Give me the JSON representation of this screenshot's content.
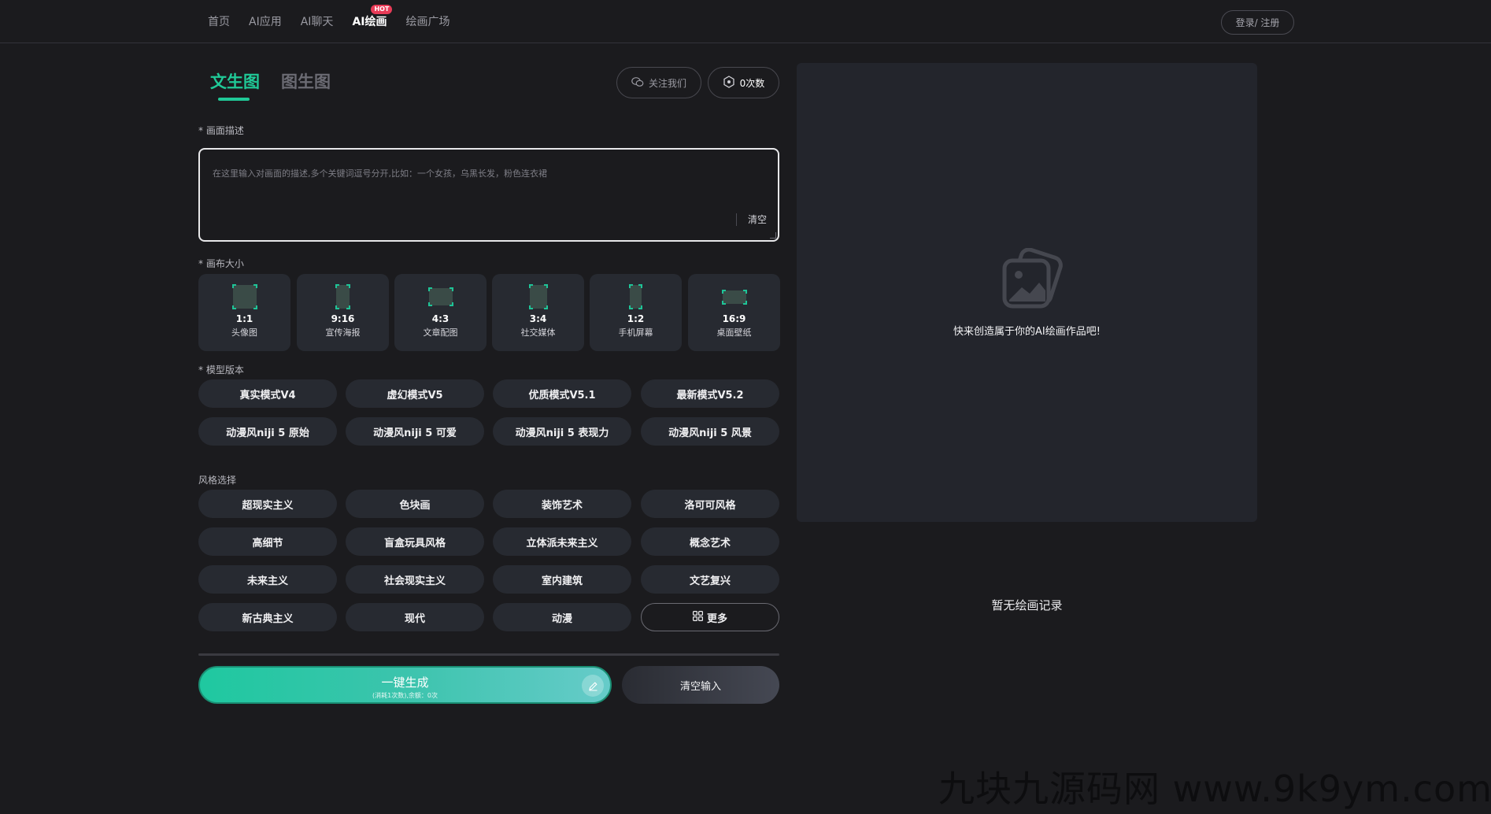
{
  "nav": {
    "items": [
      "首页",
      "AI应用",
      "AI聊天",
      "AI绘画",
      "绘画广场"
    ],
    "hot_badge": "HOT",
    "login": "登录/ 注册"
  },
  "tabs": {
    "text_to_image": "文生图",
    "image_to_image": "图生图"
  },
  "header_buttons": {
    "follow": "关注我们",
    "credits": "0次数"
  },
  "prompt": {
    "label": "* 画面描述",
    "placeholder": "在这里输入对画面的描述,多个关键词逗号分开,比如：一个女孩，乌黑长发，粉色连衣裙",
    "clear": "清空"
  },
  "canvas_size": {
    "label": "* 画布大小",
    "options": [
      {
        "ratio": "1:1",
        "name": "头像图"
      },
      {
        "ratio": "9:16",
        "name": "宣传海报"
      },
      {
        "ratio": "4:3",
        "name": "文章配图"
      },
      {
        "ratio": "3:4",
        "name": "社交媒体"
      },
      {
        "ratio": "1:2",
        "name": "手机屏幕"
      },
      {
        "ratio": "16:9",
        "name": "桌面壁纸"
      }
    ]
  },
  "model": {
    "label": "* 模型版本",
    "options": [
      "真实模式V4",
      "虚幻模式V5",
      "优质模式V5.1",
      "最新模式V5.2",
      "动漫风niji 5 原始",
      "动漫风niji 5 可爱",
      "动漫风niji 5 表现力",
      "动漫风niji 5 风景"
    ]
  },
  "style": {
    "label": "风格选择",
    "options": [
      "超现实主义",
      "色块画",
      "装饰艺术",
      "洛可可风格",
      "高细节",
      "盲盒玩具风格",
      "立体派未来主义",
      "概念艺术",
      "未来主义",
      "社会现实主义",
      "室内建筑",
      "文艺复兴",
      "新古典主义",
      "现代",
      "动漫"
    ],
    "more": "更多"
  },
  "actions": {
    "generate": "一键生成",
    "generate_sub": "(消耗1次数),余额：0次",
    "clear_input": "清空输入"
  },
  "preview": {
    "hint": "快来创造属于你的AI绘画作品吧!",
    "no_record": "暂无绘画记录"
  },
  "watermark": "九块九源码网 www.9k9ym.com",
  "colors": {
    "accent": "#20c997",
    "background": "#1b1b1e",
    "panel": "#23252c",
    "chip": "#272a31",
    "hot": "#e83b57"
  }
}
